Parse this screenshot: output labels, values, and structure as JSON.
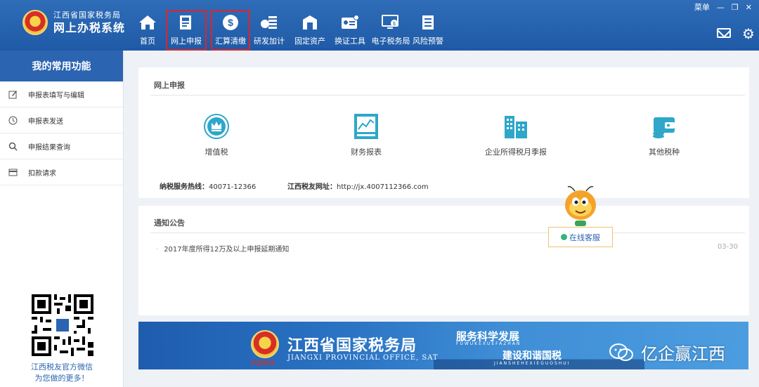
{
  "window": {
    "menu_label": "菜单",
    "minimize": "—",
    "restore": "❐",
    "close": "✕"
  },
  "brand": {
    "sub": "江西省国家税务局",
    "main": "网上办税系统"
  },
  "nav": [
    {
      "label": "首页",
      "icon": "home-icon"
    },
    {
      "label": "网上申报",
      "icon": "document-icon"
    },
    {
      "label": "汇算清缴",
      "icon": "dollar-icon"
    },
    {
      "label": "研发加计",
      "icon": "coins-icon"
    },
    {
      "label": "固定资产",
      "icon": "building-icon"
    },
    {
      "label": "换证工具",
      "icon": "id-card-icon"
    },
    {
      "label": "电子税务局",
      "icon": "monitor-icon"
    },
    {
      "label": "风险预警",
      "icon": "checklist-icon"
    }
  ],
  "sidebar": {
    "title": "我的常用功能",
    "items": [
      {
        "label": "申报表填写与编辑",
        "icon": "edit-icon"
      },
      {
        "label": "申报表发送",
        "icon": "send-icon"
      },
      {
        "label": "申报结果查询",
        "icon": "search-icon"
      },
      {
        "label": "扣款请求",
        "icon": "wallet-icon"
      }
    ],
    "qr_caption_line1": "江西税友官方微信",
    "qr_caption_line2": "为您做的更多！"
  },
  "declaration": {
    "title": "网上申报",
    "items": [
      {
        "label": "增值税",
        "icon": "crown-icon"
      },
      {
        "label": "财务报表",
        "icon": "chart-icon"
      },
      {
        "label": "企业所得税月季报",
        "icon": "buildings-icon"
      },
      {
        "label": "其他税种",
        "icon": "wallet-icon"
      }
    ],
    "hotline_label": "纳税服务热线：",
    "hotline_value": "40071-12366",
    "site_label": "江西税友网址：",
    "site_value": "http://jx.4007112366.com"
  },
  "notice": {
    "title": "通知公告",
    "items": [
      {
        "text": "2017年度所得12万及以上申报延期通知",
        "date": "03-30"
      }
    ]
  },
  "customer_service": {
    "label": "在线客服"
  },
  "banner": {
    "title": "江西省国家税务局",
    "title_en": "JIANGXI PROVINCIAL OFFICE, SAT",
    "china_tax": "中国税务",
    "slogan1": "服务科学发展",
    "slogan1_en": "FUWUKEXUEFAZHAN",
    "slogan2": "建设和谐国税",
    "slogan2_en": "JIANSHEHEXIEGUOSHUI"
  },
  "watermark": {
    "text": "亿企赢江西"
  }
}
